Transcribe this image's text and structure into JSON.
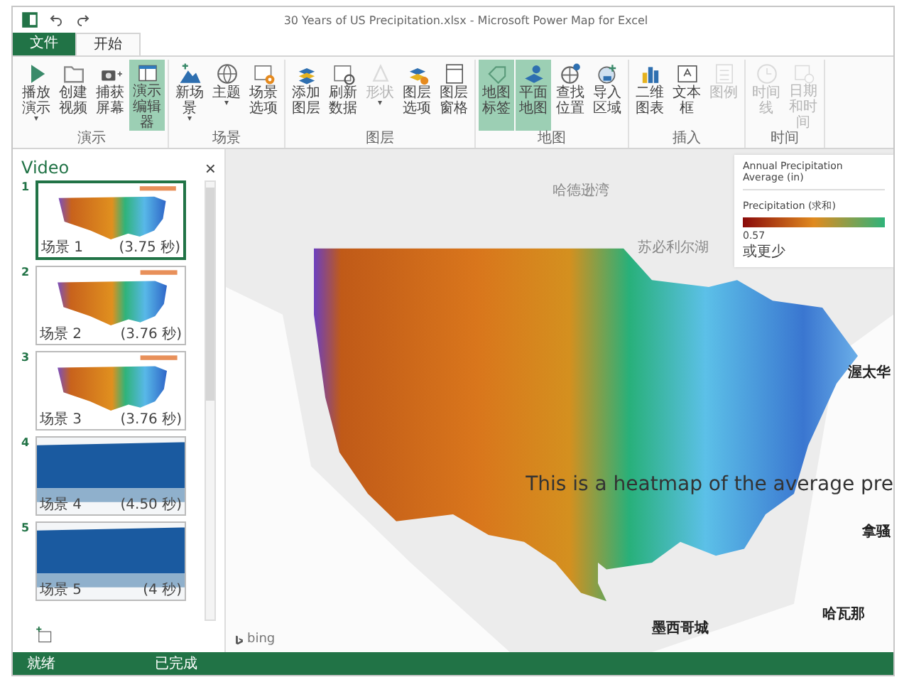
{
  "window": {
    "title": "30 Years of US Precipitation.xlsx - Microsoft Power Map for Excel"
  },
  "tabs": [
    {
      "label": "文件",
      "kind": "file",
      "selected": false
    },
    {
      "label": "开始",
      "kind": "tab",
      "selected": true
    }
  ],
  "ribbon_groups": [
    {
      "label": "演示",
      "buttons": [
        {
          "label": "播放演示",
          "selected": false,
          "disabled": false,
          "dropdown": true
        },
        {
          "label": "创建视频",
          "selected": false,
          "disabled": false,
          "dropdown": false
        },
        {
          "label": "捕获屏幕",
          "selected": false,
          "disabled": false,
          "dropdown": false
        },
        {
          "label": "演示编辑器",
          "selected": true,
          "disabled": false,
          "dropdown": false
        }
      ]
    },
    {
      "label": "场景",
      "buttons": [
        {
          "label": "新场景",
          "selected": false,
          "disabled": false,
          "dropdown": true
        },
        {
          "label": "主题",
          "selected": false,
          "disabled": false,
          "dropdown": true
        },
        {
          "label": "场景选项",
          "selected": false,
          "disabled": false,
          "dropdown": false
        }
      ]
    },
    {
      "label": "图层",
      "buttons": [
        {
          "label": "添加图层",
          "selected": false,
          "disabled": false,
          "dropdown": false
        },
        {
          "label": "刷新数据",
          "selected": false,
          "disabled": false,
          "dropdown": false
        },
        {
          "label": "形状",
          "selected": false,
          "disabled": true,
          "dropdown": true
        },
        {
          "label": "图层选项",
          "selected": false,
          "disabled": false,
          "dropdown": false
        },
        {
          "label": "图层窗格",
          "selected": false,
          "disabled": false,
          "dropdown": false
        }
      ]
    },
    {
      "label": "地图",
      "buttons": [
        {
          "label": "地图标签",
          "selected": true,
          "disabled": false,
          "dropdown": false
        },
        {
          "label": "平面地图",
          "selected": true,
          "disabled": false,
          "dropdown": false
        },
        {
          "label": "查找位置",
          "selected": false,
          "disabled": false,
          "dropdown": false
        },
        {
          "label": "导入区域",
          "selected": false,
          "disabled": false,
          "dropdown": false
        }
      ]
    },
    {
      "label": "插入",
      "buttons": [
        {
          "label": "二维图表",
          "selected": false,
          "disabled": false,
          "dropdown": false
        },
        {
          "label": "文本框",
          "selected": false,
          "disabled": false,
          "dropdown": false
        },
        {
          "label": "图例",
          "selected": false,
          "disabled": true,
          "dropdown": false
        }
      ]
    },
    {
      "label": "时间",
      "buttons": [
        {
          "label": "时间线",
          "selected": false,
          "disabled": true,
          "dropdown": false
        },
        {
          "label": "日期和时间",
          "selected": false,
          "disabled": true,
          "dropdown": false
        }
      ]
    }
  ],
  "scene_panel": {
    "title": "Video",
    "close": "×",
    "scenes": [
      {
        "number": "1",
        "name": "场景 1",
        "duration": "(3.75 秒)",
        "kind": "map",
        "selected": true
      },
      {
        "number": "2",
        "name": "场景 2",
        "duration": "(3.76 秒)",
        "kind": "map",
        "selected": false
      },
      {
        "number": "3",
        "name": "场景 3",
        "duration": "(3.76 秒)",
        "kind": "map",
        "selected": false
      },
      {
        "number": "4",
        "name": "场景 4",
        "duration": "(4.50 秒)",
        "kind": "columns",
        "selected": false
      },
      {
        "number": "5",
        "name": "场景 5",
        "duration": "(4 秒)",
        "kind": "columns",
        "selected": false
      }
    ]
  },
  "map": {
    "legend": {
      "title": "Annual Precipitation Average (in)",
      "field": "Precipitation (求和)",
      "min_value": "0.57",
      "min_label": "或更少"
    },
    "labels": [
      {
        "text": "哈德逊湾",
        "kind": "water"
      },
      {
        "text": "苏必利尔湖",
        "kind": "water"
      },
      {
        "text": "渥太华",
        "kind": "capital"
      },
      {
        "text": "墨西哥城",
        "kind": "capital"
      },
      {
        "text": "哈瓦那",
        "kind": "capital"
      },
      {
        "text": "拿骚",
        "kind": "capital"
      }
    ],
    "caption": "This is a heatmap of the average pre",
    "attribution": "bing"
  },
  "status_bar": {
    "left": "就绪",
    "right": "已完成"
  }
}
